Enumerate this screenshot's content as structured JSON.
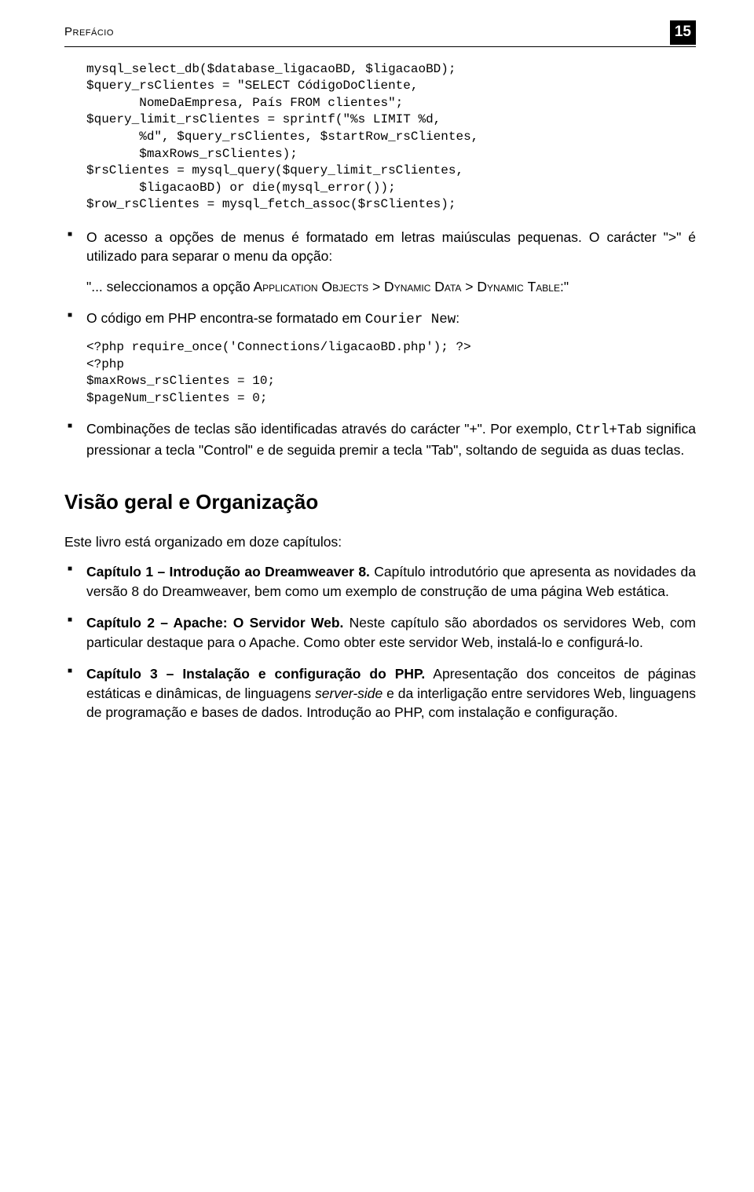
{
  "header": {
    "label": "Prefácio",
    "page": "15"
  },
  "code1": "mysql_select_db($database_ligacaoBD, $ligacaoBD);\n$query_rsClientes = \"SELECT CódigoDoCliente,\n       NomeDaEmpresa, País FROM clientes\";\n$query_limit_rsClientes = sprintf(\"%s LIMIT %d,\n       %d\", $query_rsClientes, $startRow_rsClientes,\n       $maxRows_rsClientes);\n$rsClientes = mysql_query($query_limit_rsClientes,\n       $ligacaoBD) or die(mysql_error());\n$row_rsClientes = mysql_fetch_assoc($rsClientes);",
  "bullets1": {
    "item1_a": "O acesso a opções de menus é formatado em letras maiúsculas pequenas. O carácter \">\" é utilizado para separar o menu da opção:",
    "item1_quote_a": "\"... seleccionamos a opção A",
    "item1_quote_b": "pplication ",
    "item1_quote_c": "O",
    "item1_quote_d": "bjects",
    "item1_quote_e": " > D",
    "item1_quote_f": "ynamic ",
    "item1_quote_g": "D",
    "item1_quote_h": "ata",
    "item1_quote_i": " > D",
    "item1_quote_j": "ynamic ",
    "item1_quote_k": "T",
    "item1_quote_l": "able",
    "item1_quote_m": ":\"",
    "item2_a": "O código em PHP encontra-se formatado em ",
    "item2_b": "Courier New",
    "item2_c": ":",
    "code2": "<?php require_once('Connections/ligacaoBD.php'); ?>\n<?php\n$maxRows_rsClientes = 10;\n$pageNum_rsClientes = 0;",
    "item3_a": "Combinações de teclas são identificadas através do carácter \"+\". Por exemplo, ",
    "item3_b": "Ctrl+Tab",
    "item3_c": " significa pressionar a tecla \"Control\" e de seguida premir a tecla \"Tab\", soltando de seguida as duas teclas."
  },
  "section_title": "Visão geral e Organização",
  "intro": "Este livro está organizado em doze capítulos:",
  "chapters": {
    "c1_t": "Capítulo 1 – Introdução ao Dreamweaver 8.",
    "c1_b": " Capítulo introdutório que apresenta as novidades da versão 8 do Dreamweaver, bem como um exemplo de construção de uma página Web estática.",
    "c2_t": "Capítulo 2 – Apache: O Servidor Web.",
    "c2_b": " Neste capítulo são abordados os servidores Web, com particular destaque para o Apache. Como obter este servidor Web, instalá-lo e configurá-lo.",
    "c3_t": "Capítulo 3 – Instalação e configuração do PHP.",
    "c3_b1": " Apresentação dos conceitos de páginas estáticas e dinâmicas, de linguagens ",
    "c3_i": "server-side",
    "c3_b2": " e da interligação entre servidores Web, linguagens de programação e bases de dados. Introdução ao PHP, com instalação e configuração."
  }
}
